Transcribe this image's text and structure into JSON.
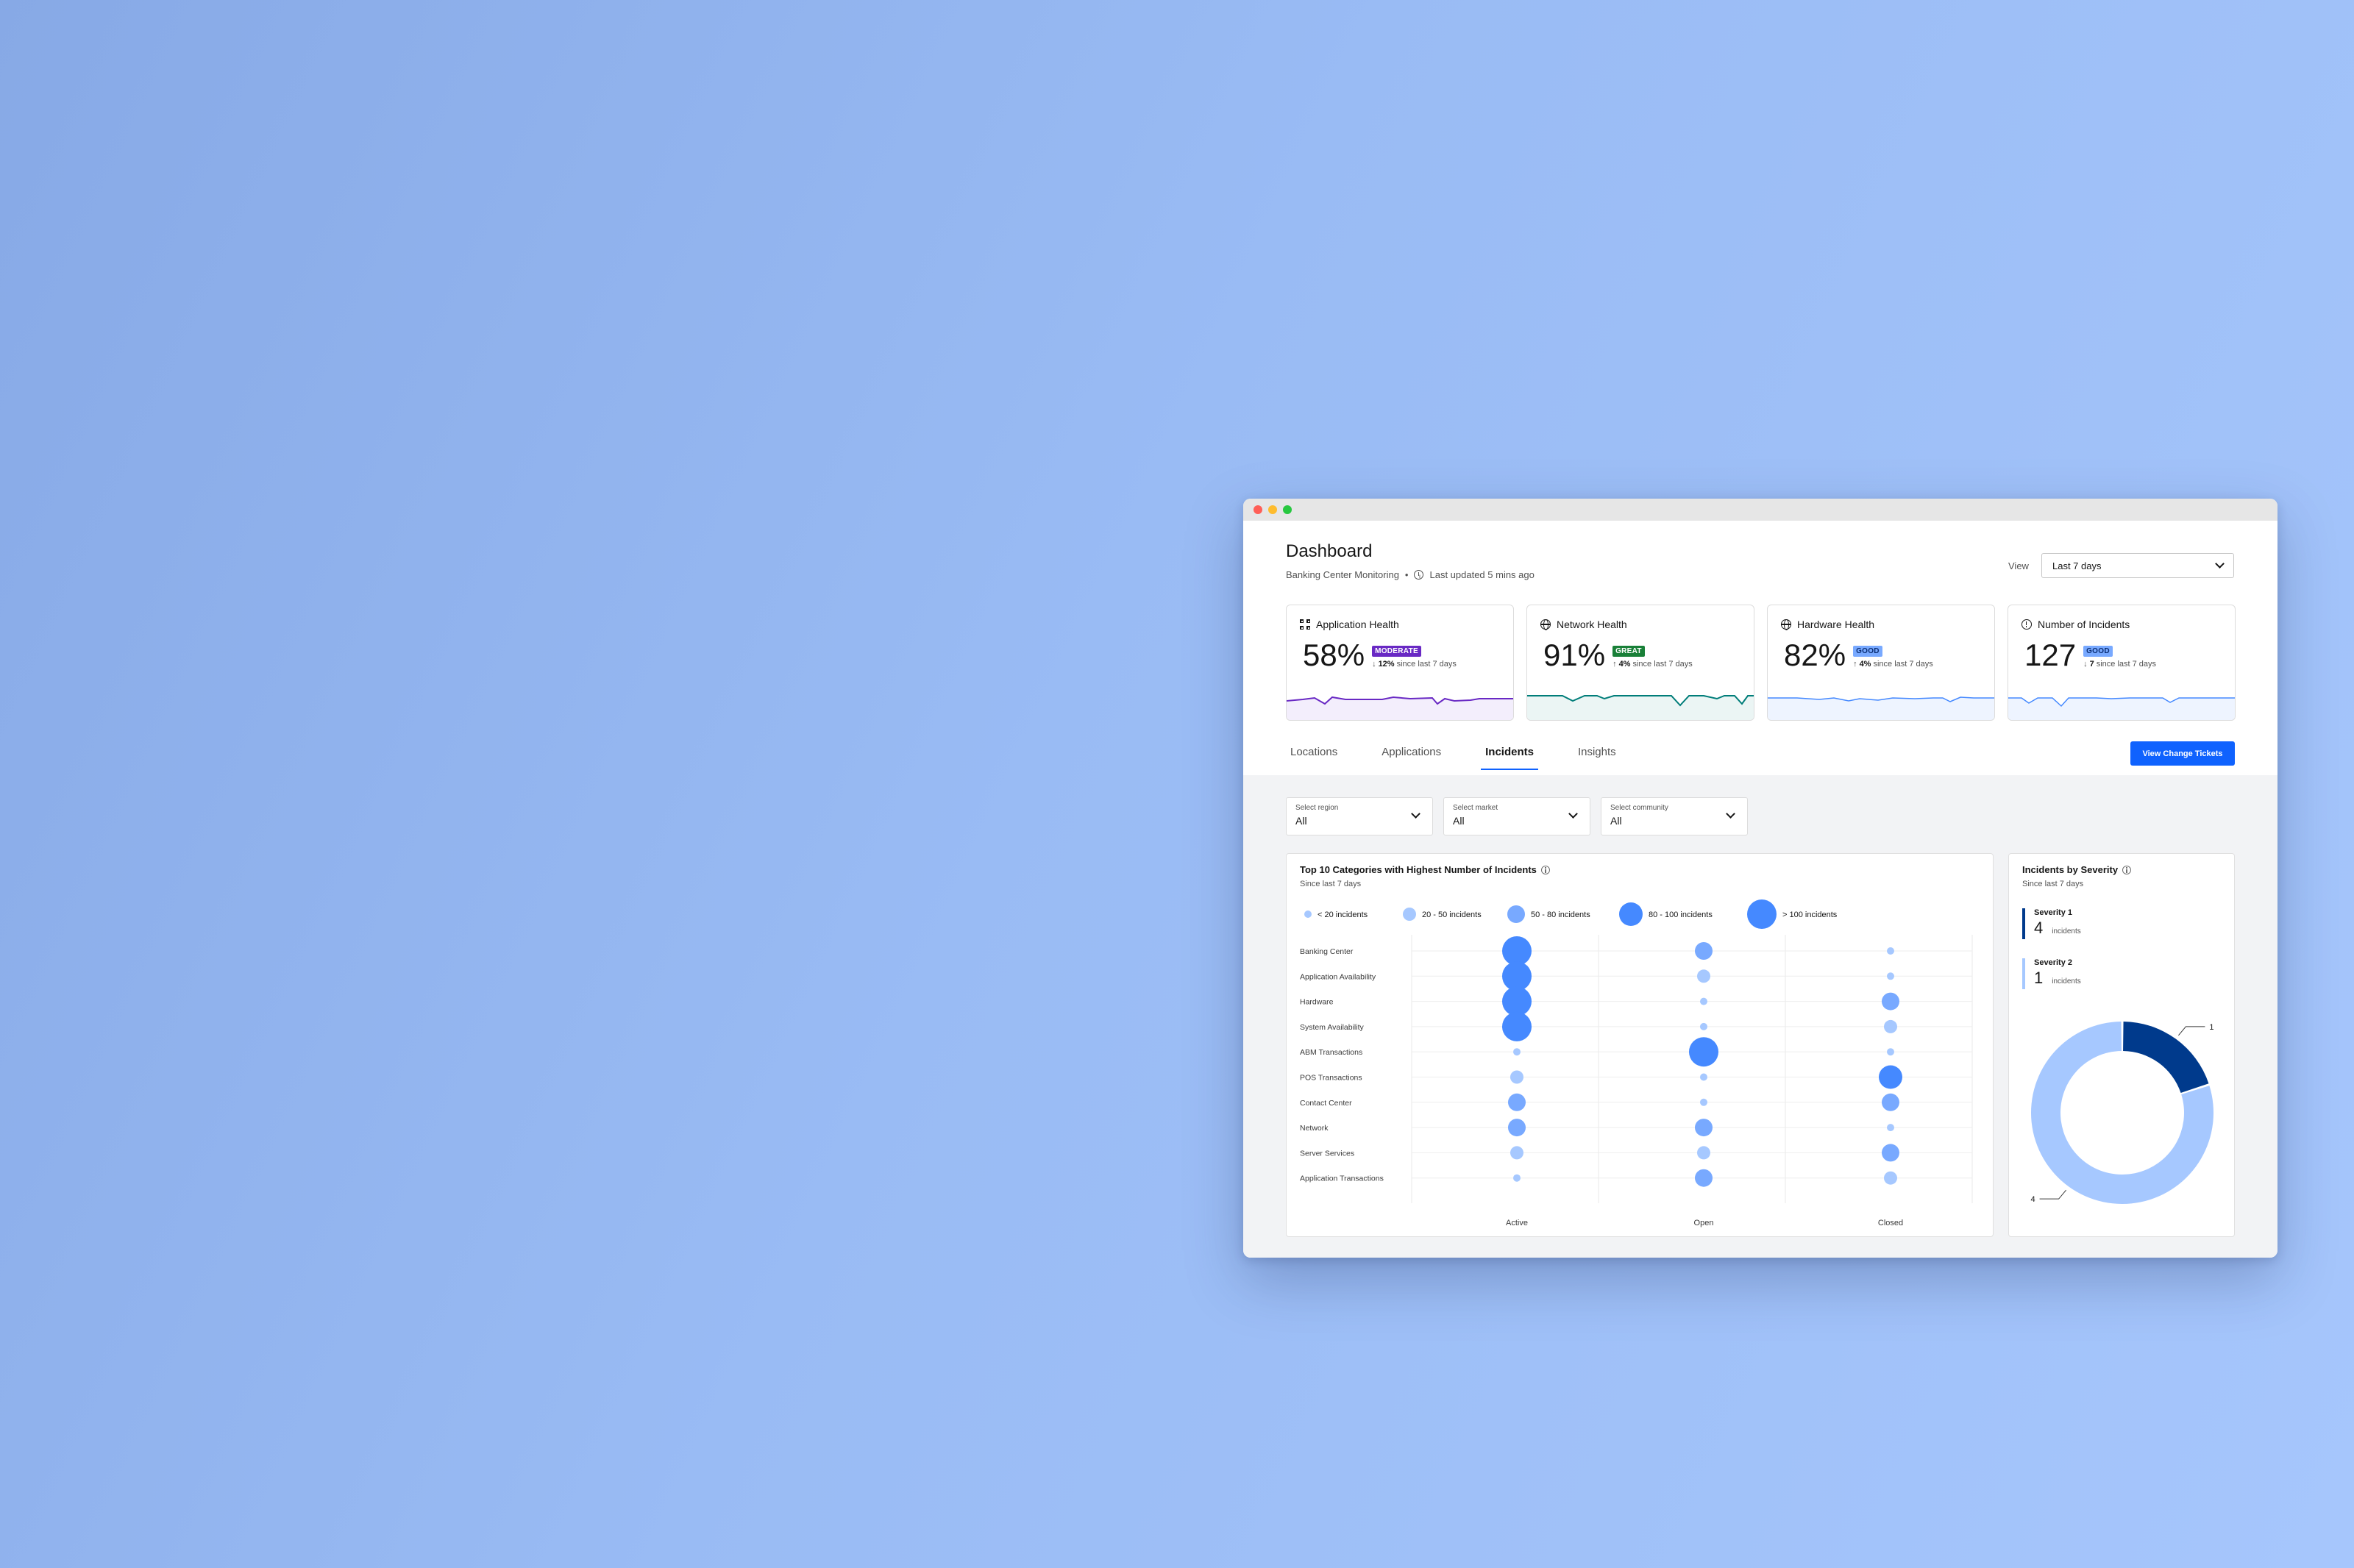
{
  "window": {
    "title": "Dashboard",
    "subtitle": "Banking Center Monitoring",
    "updated": "Last updated 5 mins ago"
  },
  "view": {
    "label": "View",
    "value": "Last 7 days"
  },
  "cards": [
    {
      "title": "Application Health",
      "value": "58%",
      "tag": "MODERATE",
      "delta": "12%",
      "delta_text": "since last 7 days",
      "direction": "down",
      "icon": "grid-icon",
      "color": "#6929c4"
    },
    {
      "title": "Network Health",
      "value": "91%",
      "tag": "GREAT",
      "delta": "4%",
      "delta_text": "since last 7 days",
      "direction": "up",
      "icon": "globe-icon",
      "color": "#007d79"
    },
    {
      "title": "Hardware Health",
      "value": "82%",
      "tag": "GOOD",
      "delta": "4%",
      "delta_text": "since last 7 days",
      "direction": "up",
      "icon": "globe-icon",
      "color": "#4589ff"
    },
    {
      "title": "Number of Incidents",
      "value": "127",
      "tag": "GOOD",
      "delta": "7",
      "delta_text": "since last 7 days",
      "direction": "down",
      "icon": "alert-icon",
      "color": "#4589ff"
    }
  ],
  "tabs": [
    "Locations",
    "Applications",
    "Incidents",
    "Insights"
  ],
  "active_tab": "Incidents",
  "button": "View Change Tickets",
  "filters": [
    {
      "label": "Select region",
      "value": "All"
    },
    {
      "label": "Select market",
      "value": "All"
    },
    {
      "label": "Select community",
      "value": "All"
    }
  ],
  "bubble_panel": {
    "title": "Top 10 Categories with Highest Number of Incidents",
    "subtitle": "Since last 7 days"
  },
  "severity_panel": {
    "title": "Incidents by Severity",
    "subtitle": "Since last 7 days",
    "items": [
      {
        "label": "Severity 1",
        "value": "4",
        "unit": "incidents"
      },
      {
        "label": "Severity 2",
        "value": "1",
        "unit": "incidents"
      }
    ]
  },
  "chart_data": [
    {
      "type": "scatter",
      "title": "Top 10 Categories with Highest Number of Incidents",
      "subtitle": "Since last 7 days",
      "legend": [
        "< 20 incidents",
        "20 - 50 incidents",
        "50 - 80 incidents",
        "80 - 100 incidents",
        "> 100 incidents"
      ],
      "legend_placement": "top",
      "x_categories": [
        "Active",
        "Open",
        "Closed"
      ],
      "y_categories": [
        "Banking Center",
        "Application Availability",
        "Hardware",
        "System Availability",
        "ABM Transactions",
        "POS Transactions",
        "Contact Center",
        "Network",
        "Server Services",
        "Application Transactions"
      ],
      "bucket_matrix": [
        [
          4,
          2,
          0
        ],
        [
          4,
          1,
          0
        ],
        [
          4,
          0,
          2
        ],
        [
          4,
          0,
          1
        ],
        [
          0,
          4,
          0
        ],
        [
          1,
          0,
          3
        ],
        [
          2,
          0,
          2
        ],
        [
          2,
          2,
          0
        ],
        [
          1,
          1,
          2
        ],
        [
          0,
          2,
          1
        ]
      ],
      "bucket_meaning": "index into legend",
      "colors": [
        "#a6c8ff",
        "#4589ff"
      ],
      "grid": true
    },
    {
      "type": "pie",
      "title": "Incidents by Severity",
      "subtitle": "Since last 7 days",
      "categories": [
        "Severity 1",
        "Severity 2"
      ],
      "values": [
        1,
        4
      ],
      "data_labels": [
        "1",
        "4"
      ],
      "colors": [
        "#003a8c",
        "#a6c8ff"
      ]
    }
  ]
}
